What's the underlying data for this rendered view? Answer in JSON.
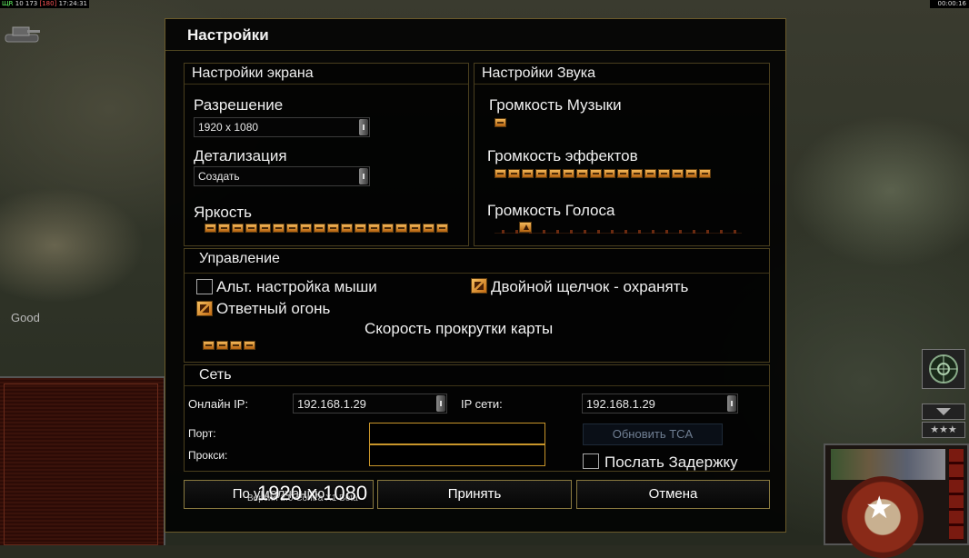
{
  "hud": {
    "left_green": "ЩR",
    "left_numbers": "10 173",
    "left_bracket": "[180]",
    "left_time": "17:24:31",
    "right_time": "00:00:16",
    "good_label": "Good"
  },
  "dialog": {
    "title": "Настройки",
    "screen": {
      "title": "Настройки экрана",
      "resolution_label": "Разрешение",
      "resolution_value": "1920 x 1080",
      "detail_label": "Детализация",
      "detail_value": "Создать",
      "brightness_label": "Яркость",
      "brightness_level": 1.0
    },
    "sound": {
      "title": "Настройки Звука",
      "music_label": "Громкость Музыки",
      "music_level": 0.0,
      "effects_label": "Громкость эффектов",
      "effects_level": 1.0,
      "voice_label": "Громкость Голоса",
      "voice_level": 0.1
    },
    "controls": {
      "title": "Управление",
      "alt_mouse_label": "Альт. настройка мыши",
      "alt_mouse_checked": false,
      "double_click_label": "Двойной щелчок - охранять",
      "double_click_checked": true,
      "return_fire_label": "Ответный огонь",
      "return_fire_checked": true,
      "scroll_speed_label": "Скорость прокрутки карты",
      "scroll_speed_level": 0.5
    },
    "network": {
      "title": "Сеть",
      "online_ip_label": "Онлайн IP:",
      "online_ip_value": "192.168.1.29",
      "lan_ip_label": "IP сети:",
      "lan_ip_value": "192.168.1.29",
      "port_label": "Порт:",
      "port_value": "",
      "proxy_label": "Прокси:",
      "proxy_value": "",
      "update_tca_label": "Обновить TCA",
      "send_delay_label": "Послать Задержку",
      "send_delay_checked": false
    },
    "buttons": {
      "defaults": "По умолчанию",
      "accept": "Принять",
      "cancel": "Отмена"
    },
    "version_text": "Версия 2.0 Contra X1 Beta",
    "resolution_overlay": "1920 x 1080"
  },
  "colors": {
    "accent_orange": "#e0962f",
    "frame_gold": "#6b5a2a",
    "dialog_bg": "#030303"
  }
}
